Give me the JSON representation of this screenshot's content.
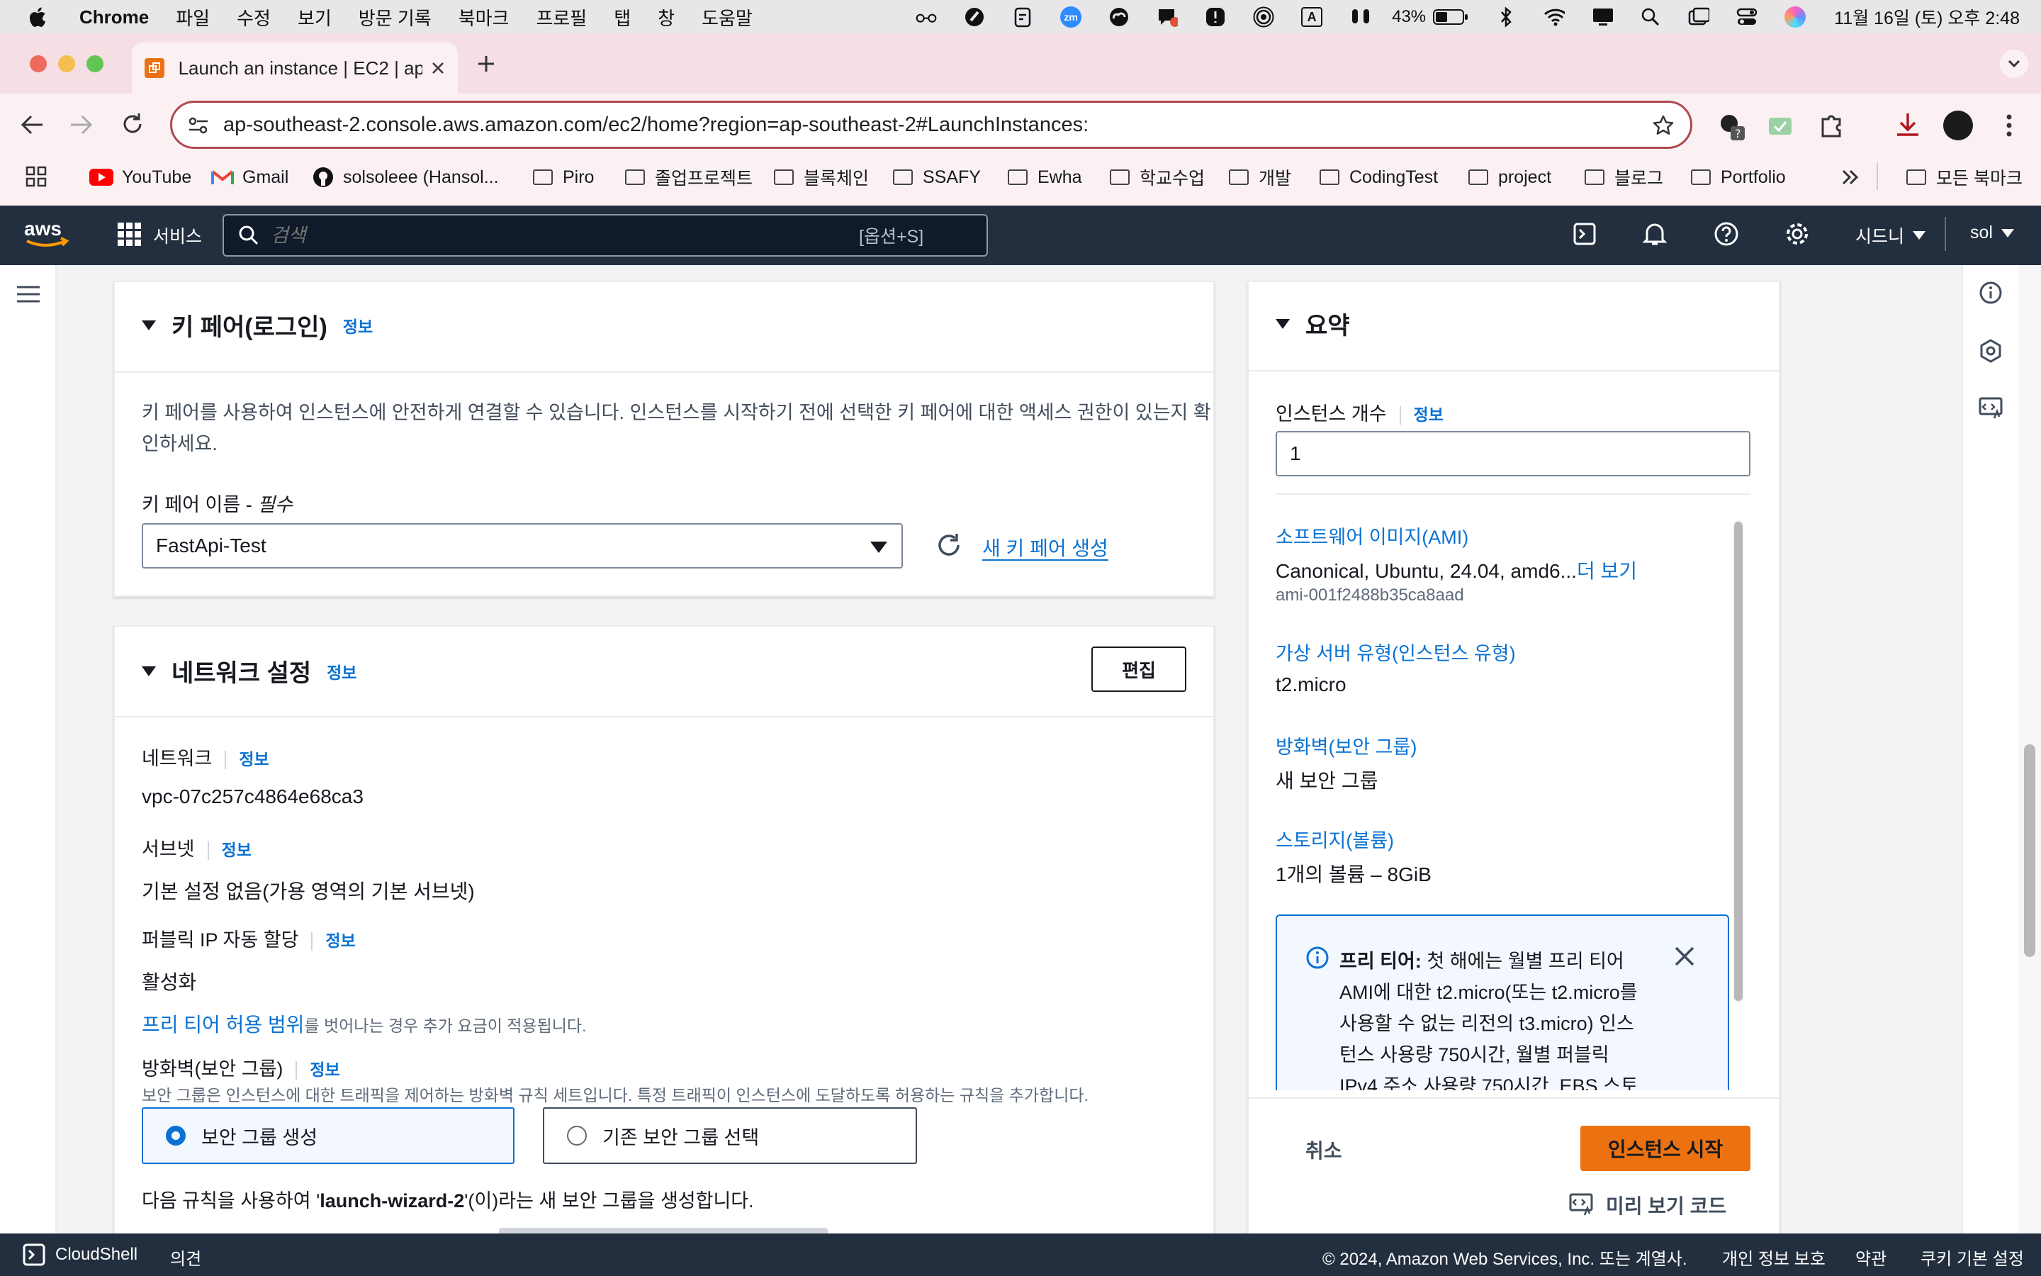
{
  "menubar": {
    "app": "Chrome",
    "items": [
      "파일",
      "수정",
      "보기",
      "방문 기록",
      "북마크",
      "프로필",
      "탭",
      "창",
      "도움말"
    ],
    "battery": "43%",
    "datetime": "11월 16일 (토) 오후 2:48",
    "input_indicator": "A",
    "zoom_badge": "zm"
  },
  "browser": {
    "tab_title": "Launch an instance | EC2 | ap",
    "url": "ap-southeast-2.console.aws.amazon.com/ec2/home?region=ap-southeast-2#LaunchInstances:",
    "bookmarks": [
      "YouTube",
      "Gmail",
      "solsoleee (Hansol...",
      "Piro",
      "졸업프로젝트",
      "블록체인",
      "SSAFY",
      "Ewha",
      "학교수업",
      "개발",
      "CodingTest",
      "project",
      "블로그",
      "Portfolio"
    ],
    "all_bookmarks": "모든 북마크"
  },
  "aws": {
    "services": "서비스",
    "search_placeholder": "검색",
    "search_shortcut": "[옵션+S]",
    "region": "시드니",
    "user": "sol"
  },
  "keypair": {
    "title": "키 페어(로그인)",
    "info": "정보",
    "description_line1": "키 페어를 사용하여 인스턴스에 안전하게 연결할 수 있습니다. 인스턴스를 시작하기 전에 선택한 키 페어에 대한 액세스 권한이 있는지 확",
    "description_line2": "인하세요.",
    "name_label": "키 페어 이름 - ",
    "required": "필수",
    "selected": "FastApi-Test",
    "create_link": "새 키 페어 생성"
  },
  "network": {
    "title": "네트워크 설정",
    "info": "정보",
    "edit": "편집",
    "network_label": "네트워크",
    "network_value": "vpc-07c257c4864e68ca3",
    "subnet_label": "서브넷",
    "subnet_value": "기본 설정 없음(가용 영역의 기본 서브넷)",
    "public_ip_label": "퍼블릭 IP 자동 할당",
    "public_ip_value": "활성화",
    "free_tier_link": "프리 티어 허용 범위",
    "free_tier_text": "를 벗어나는 경우 추가 요금이 적용됩니다.",
    "firewall_label": "방화벽(보안 그룹)",
    "firewall_desc": "보안 그룹은 인스턴스에 대한 트래픽을 제어하는 방화벽 규칙 세트입니다. 특정 트래픽이 인스턴스에 도달하도록 허용하는 규칙을 추가합니다.",
    "option_create": "보안 그룹 생성",
    "option_existing": "기존 보안 그룹 선택",
    "rule_prefix": "다음 규칙을 사용하여 '",
    "rule_name": "launch-wizard-2",
    "rule_suffix": "'(이)라는 새 보안 그룹을 생성합니다."
  },
  "summary": {
    "title": "요약",
    "count_label": "인스턴스 개수",
    "info": "정보",
    "count_value": "1",
    "ami_label": "소프트웨어 이미지(AMI)",
    "ami_value": "Canonical, Ubuntu, 24.04, amd6...",
    "ami_more": "더 보기",
    "ami_id": "ami-001f2488b35ca8aad",
    "type_label": "가상 서버 유형(인스턴스 유형)",
    "type_value": "t2.micro",
    "sg_label": "방화벽(보안 그룹)",
    "sg_value": "새 보안 그룹",
    "storage_label": "스토리지(볼륨)",
    "storage_value": "1개의 볼륨 – 8GiB",
    "free_tier_bold": "프리 티어:",
    "free_tier_lines": [
      " 첫 해에는 월별 프리 티어",
      "AMI에 대한 t2.micro(또는 t2.micro를",
      "사용할 수 없는 리전의 t3.micro) 인스",
      "턴스 사용량 750시간, 월별 퍼블릭",
      "IPv4 주소 사용량 750시간, EBS 스토"
    ],
    "cancel": "취소",
    "launch": "인스턴스 시작",
    "preview": "미리 보기 코드"
  },
  "footer": {
    "cloudshell": "CloudShell",
    "feedback": "의견",
    "copyright": "© 2024, Amazon Web Services, Inc. 또는 계열사.",
    "privacy": "개인 정보 보호",
    "terms": "약관",
    "cookies": "쿠키 기본 설정"
  },
  "colors": {
    "aws_nav": "#232f3e",
    "aws_link": "#0972d3",
    "launch_button": "#ec7211",
    "tab_strip": "#f5dfe4"
  }
}
